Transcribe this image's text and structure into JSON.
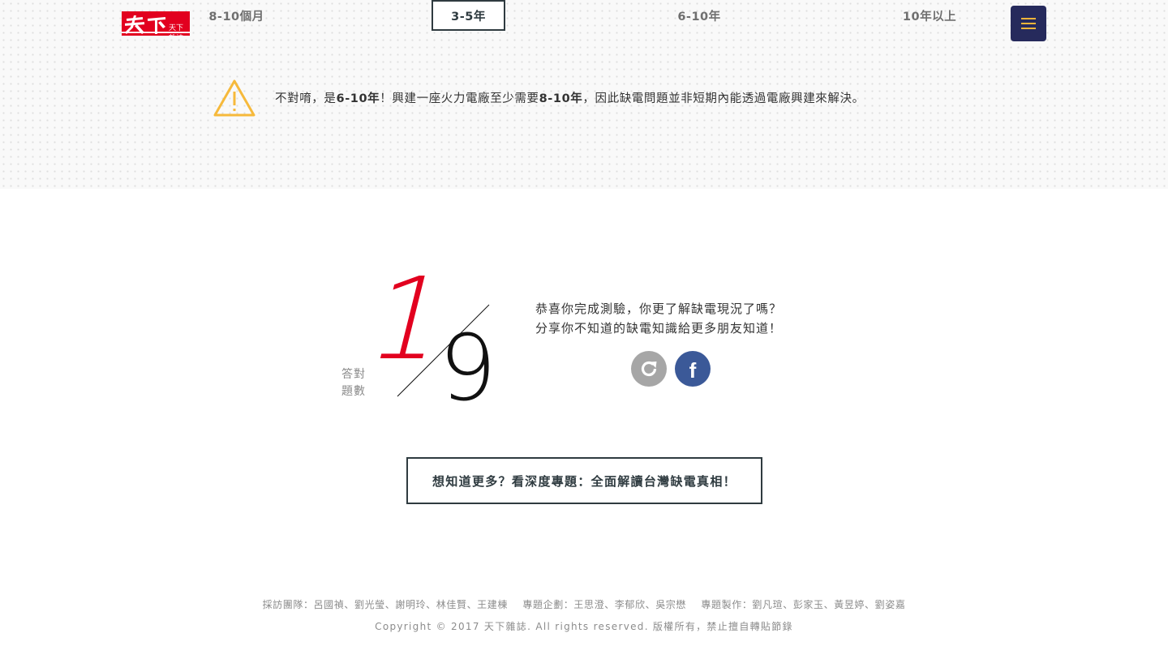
{
  "header": {
    "logo_text": "天下雜誌",
    "options": [
      {
        "label": "8-10個月",
        "selected": false
      },
      {
        "label": "3-5年",
        "selected": true
      },
      {
        "label": "6-10年",
        "selected": false
      },
      {
        "label": "10年以上",
        "selected": false
      }
    ],
    "menu_icon": "hamburger-icon",
    "menu_color": "#262a5c",
    "menu_icon_color": "#f0b43a"
  },
  "feedback": {
    "icon": "warning-icon",
    "icon_color": "#f6b93b",
    "prefix": "不對唷，是",
    "answer": "6-10年",
    "middle": "！興建一座火力電廠至少需要",
    "duration": "8-10年",
    "suffix": "，因此缺電問題並非短期內能透過電廠興建來解決。"
  },
  "result": {
    "label_line1": "答對",
    "label_line2": "題數",
    "correct": "1",
    "total": "9",
    "correct_color": "#e2001f",
    "message_line1": "恭喜你完成測驗，你更了解缺電現況了嗎？",
    "message_line2": "分享你不知道的缺電知識給更多朋友知道！",
    "retry_icon": "refresh-icon",
    "share_icon": "facebook-icon",
    "facebook_letter": "f"
  },
  "more_link": {
    "label": "想知道更多？看深度專題：全面解讀台灣缺電真相！"
  },
  "footer": {
    "credits": [
      "採訪團隊：呂國禎、劉光瑩、謝明玲、林佳賢、王建棟",
      "專題企劃：王思澄、李郁欣、吳宗懋",
      "專題製作：劉凡瑄、彭家玉、黃昱婷、劉姿嘉"
    ],
    "copyright": "Copyright © 2017 天下雜誌.   All rights reserved. 版權所有，禁止擅自轉貼節錄"
  }
}
